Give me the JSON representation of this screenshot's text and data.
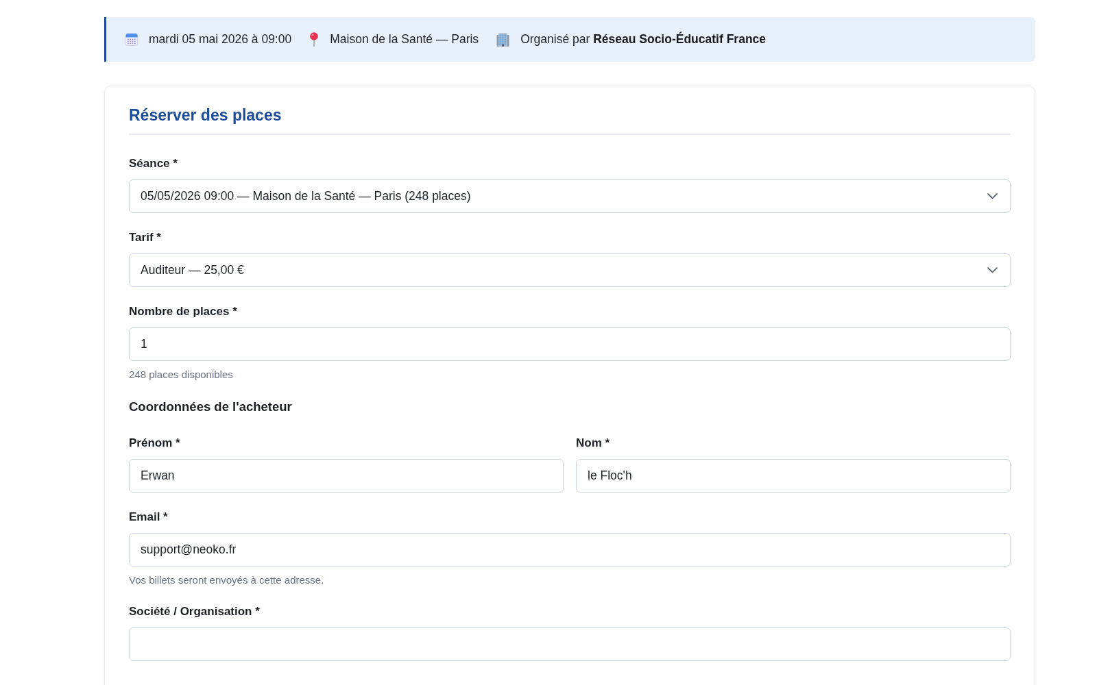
{
  "event_banner": {
    "items": [
      {
        "kind": "date",
        "text": "mardi 05 mai 2026 à 09:00"
      },
      {
        "kind": "location",
        "text": "Maison de la Santé — Paris"
      },
      {
        "kind": "organizer",
        "text": "Organisé par **Réseau Socio-Éducatif France**"
      }
    ]
  },
  "booking_form": {
    "title": "Réserver des places",
    "fields": [
      {
        "kind": "select",
        "label": "Séance *",
        "value": "05/05/2026 09:00 — Maison de la Santé — Paris (248 places)"
      },
      {
        "kind": "select",
        "label": "Tarif *",
        "value": "Auditeur — 25,00 €"
      },
      {
        "kind": "input",
        "label": "Nombre de places *",
        "value": "1",
        "hint": "248 places disponibles"
      },
      {
        "kind": "heading",
        "text": "Coordonnées de l'acheteur"
      },
      {
        "kind": "row",
        "fields": [
          {
            "kind": "input",
            "label": "Prénom *",
            "value": "Erwan"
          },
          {
            "kind": "input",
            "label": "Nom *",
            "value": "le Floc'h"
          }
        ]
      },
      {
        "kind": "input",
        "label": "Email *",
        "value": "support@neoko.fr",
        "hint": "Vos billets seront envoyés à cette adresse."
      },
      {
        "kind": "input",
        "label": "Société / Organisation *"
      }
    ]
  }
}
